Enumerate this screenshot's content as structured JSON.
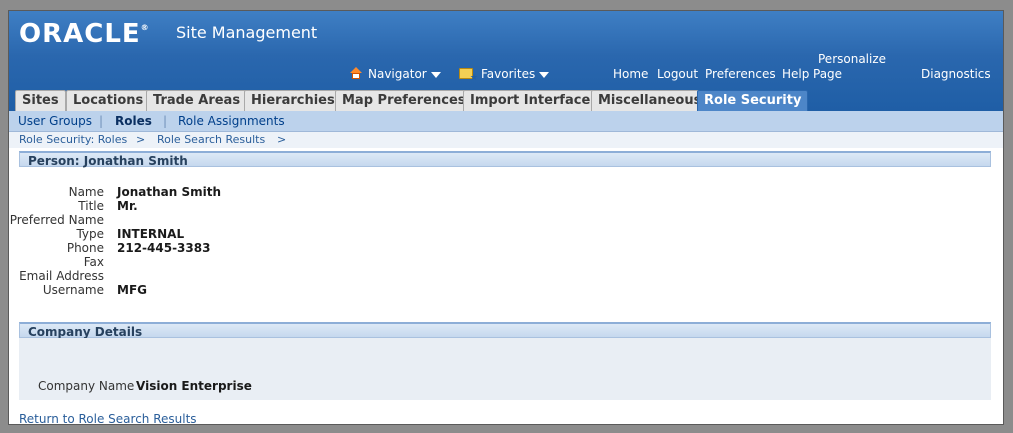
{
  "header": {
    "logo": "ORACLE",
    "app_title": "Site Management",
    "navigator": "Navigator",
    "favorites": "Favorites",
    "home": "Home",
    "logout": "Logout",
    "preferences": "Preferences",
    "help": "Help",
    "personalize_line1": "Personalize",
    "personalize_line2": "Page",
    "diagnostics": "Diagnostics"
  },
  "tabs": [
    {
      "label": "Sites"
    },
    {
      "label": "Locations"
    },
    {
      "label": "Trade Areas"
    },
    {
      "label": "Hierarchies"
    },
    {
      "label": "Map Preferences"
    },
    {
      "label": "Import Interface"
    },
    {
      "label": "Miscellaneous"
    },
    {
      "label": "Role Security",
      "active": true
    }
  ],
  "subtabs": [
    {
      "label": "User Groups"
    },
    {
      "label": "Roles",
      "active": true
    },
    {
      "label": "Role Assignments"
    }
  ],
  "breadcrumbs": [
    {
      "label": "Role Security: Roles"
    },
    {
      "label": "Role Search Results"
    }
  ],
  "crumb_separator": ">",
  "person": {
    "section_title": "Person: Jonathan Smith",
    "fields": [
      {
        "label": "Name",
        "value": "Jonathan Smith"
      },
      {
        "label": "Title",
        "value": "Mr."
      },
      {
        "label": "Preferred Name",
        "value": ""
      },
      {
        "label": "Type",
        "value": "INTERNAL"
      },
      {
        "label": "Phone",
        "value": "212-445-3383"
      },
      {
        "label": "Fax",
        "value": ""
      },
      {
        "label": "Email Address",
        "value": ""
      },
      {
        "label": "Username",
        "value": "MFG"
      }
    ]
  },
  "company": {
    "section_title": "Company Details",
    "name_label": "Company Name",
    "name_value": "Vision Enterprise"
  },
  "return_link": "Return to Role Search Results",
  "colors": {
    "header_blue": "#2a67ae",
    "active_tab": "#4d86c8",
    "subtab_bar": "#bcd2ec",
    "link": "#2a5e9a"
  }
}
